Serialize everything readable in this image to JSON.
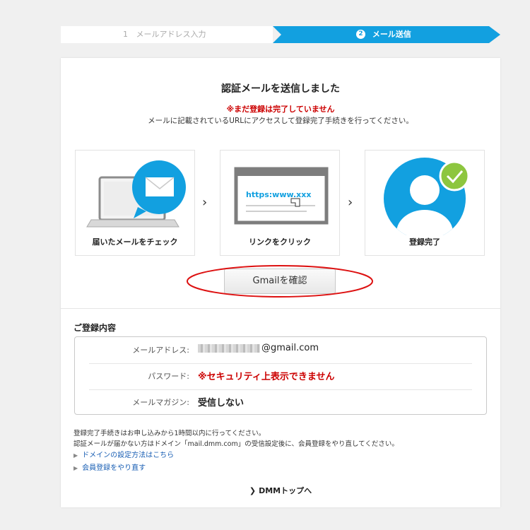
{
  "steps": {
    "step1_num": "1",
    "step1_label": "メールアドレス入力",
    "step2_num": "2",
    "step2_label": "メール送信"
  },
  "header": {
    "title": "認証メールを送信しました",
    "warning": "※まだ登録は完了していません",
    "description": "メールに記載されているURLにアクセスして登録完了手続きを行ってください。"
  },
  "process": {
    "items": [
      {
        "caption": "届いたメールをチェック"
      },
      {
        "caption": "リンクをクリック",
        "url_text": "https:www.xxx"
      },
      {
        "caption": "登録完了"
      }
    ],
    "arrow": "›"
  },
  "gmail_button": "Gmailを確認",
  "registration": {
    "title": "ご登録内容",
    "rows": [
      {
        "label": "メールアドレス:",
        "value": "@gmail.com"
      },
      {
        "label": "パスワード:",
        "value": "※セキュリティ上表示できません"
      },
      {
        "label": "メールマガジン:",
        "value": "受信しない"
      }
    ]
  },
  "notes": [
    "登録完了手続きはお申し込みから1時間以内に行ってください。",
    "認証メールが届かない方はドメイン「mail.dmm.com」の受信設定後に、会員登録をやり直してください。"
  ],
  "links": [
    "ドメインの設定方法はこちら",
    "会員登録をやり直す"
  ],
  "top_link": "DMMトップへ",
  "colors": {
    "accent": "#12a0e0",
    "warning": "#cc0000",
    "check_green": "#8dc63f",
    "link": "#1a5fb4",
    "highlight_ring": "#dd1111"
  }
}
